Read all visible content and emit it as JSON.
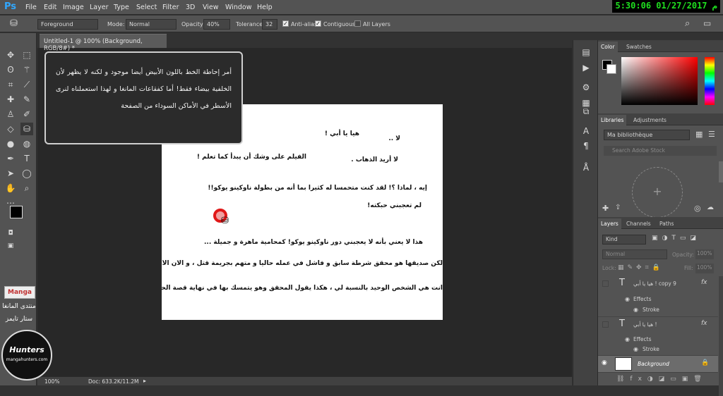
{
  "app": {
    "logo": "Ps",
    "clock": "5:30:06 01/27/2017 م"
  },
  "menu": [
    "File",
    "Edit",
    "Image",
    "Layer",
    "Type",
    "Select",
    "Filter",
    "3D",
    "View",
    "Window",
    "Help"
  ],
  "options": {
    "fill_source": "Foreground",
    "mode_label": "Mode:",
    "mode_value": "Normal",
    "opacity_label": "Opacity:",
    "opacity_value": "40%",
    "tolerance_label": "Tolerance:",
    "tolerance_value": "32",
    "antialias_label": "Anti-alias",
    "contiguous_label": "Contiguous",
    "all_layers_label": "All Layers"
  },
  "document": {
    "tab_title": "Untitled-1 @ 100% (Background, RGB/8#) *",
    "zoom": "100%",
    "doc_size": "Doc: 633.2K/11.2M",
    "lines": [
      "هيا يا أبي !",
      "لا ..",
      "الفيلم على وشك أن يبدأ كما تعلم !",
      "لا أريد الذهاب .",
      "إيه ، لماذا ؟! لقد كنت متحمسا له كثيرا بما أنه من بطولة ناوكينو يوكو!!",
      "لم تعجبني حبكته!",
      "هذا لا يعني بأنه لا يعجبني دور ناوكينو يوكو! كمحامية ماهرة و جميلة ...",
      "لكن صديقها هو محقق شرطة سابق و فاشل في عمله حاليا و متهم بجريمة قتل ، و الآن الأمر متوقف على الحكم ...",
      "أنت هي الشخص الوحيد بالنسبة لي ، هكذا يقول المحقق وهو يتمسك بها في نهاية قصة الحب الحزينة الغامضة"
    ]
  },
  "tooltip": "أمر إحاطة الخط باللون الأبيض أيضا موجود و لكنه لا يظهر لأن الخلفية بيضاء فقط! أما كفقاعات المانغا و لهذا استعملناه لنرى الأسطر في الأماكن السوداء من الصفحة",
  "watermark": {
    "logo_text": "Manga",
    "line1": "منتدى المانغا",
    "line2": "ستار تايمز",
    "badge_top": "Hunters",
    "badge_bottom": "mangahunters.com"
  },
  "panels": {
    "color_tabs": [
      "Color",
      "Swatches"
    ],
    "lib_tabs": [
      "Libraries",
      "Adjustments"
    ],
    "library_name": "Ma bibliothèque",
    "search_placeholder": "Search Adobe Stock",
    "layer_tabs": [
      "Layers",
      "Channels",
      "Paths"
    ],
    "kind": "Kind",
    "blend": "Normal",
    "opacity_label": "Opacity:",
    "opacity_value": "100%",
    "lock_label": "Lock:",
    "fill_label": "Fill:",
    "fill_value": "100%",
    "layers": [
      {
        "name": "هيا يا أبي ! copy 9",
        "effects": "Effects",
        "stroke": "Stroke"
      },
      {
        "name": "هيا يا أبي !",
        "effects": "Effects",
        "stroke": "Stroke"
      },
      {
        "name": "Background"
      }
    ]
  },
  "colors": {
    "accent": "#31a8ff",
    "clock": "#1fe01f",
    "cursor_ring": "#e01818"
  }
}
